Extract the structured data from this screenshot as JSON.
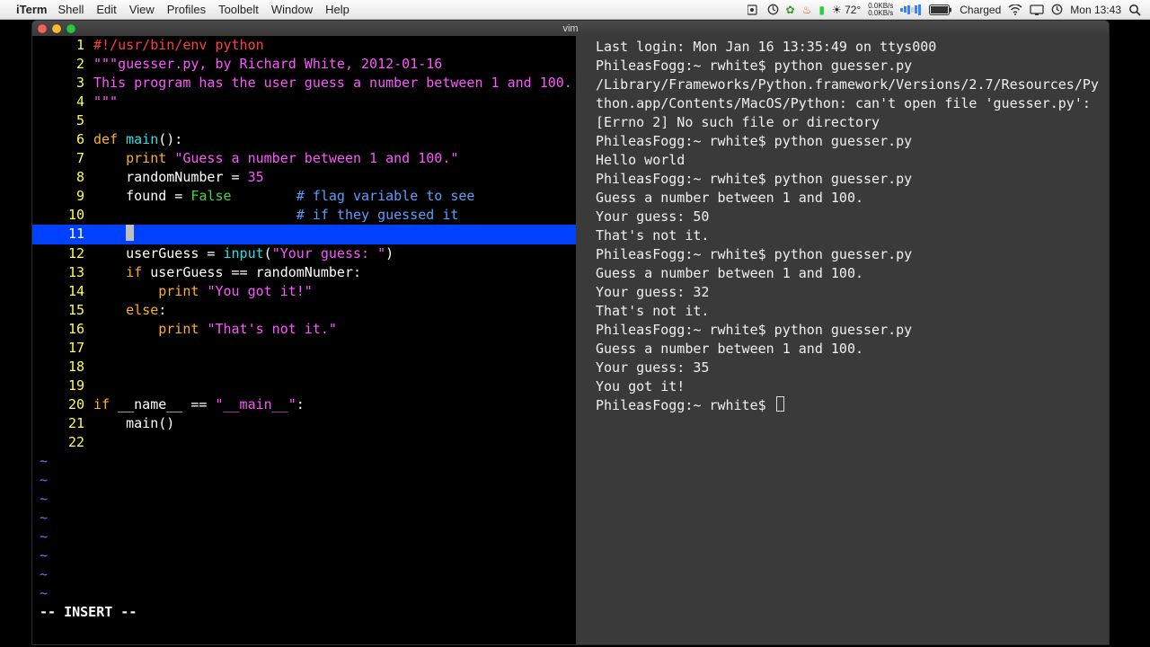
{
  "menubar": {
    "app": "iTerm",
    "menus": [
      "Shell",
      "Edit",
      "View",
      "Profiles",
      "Toolbelt",
      "Window",
      "Help"
    ],
    "weather": "☀ 72°",
    "net": "0.0KB/s\n0.0KB/s",
    "battery": "Charged",
    "clock": "Mon 13:43"
  },
  "window": {
    "title": "vim"
  },
  "vim": {
    "status": "-- INSERT --",
    "cursor_line": 11,
    "lines": [
      {
        "n": 1,
        "seg": [
          [
            "c-red",
            "#!/usr/bin/env python"
          ]
        ]
      },
      {
        "n": 2,
        "seg": [
          [
            "c-mag",
            "\"\"\"guesser.py, by Richard White, 2012-01-16"
          ]
        ]
      },
      {
        "n": 3,
        "seg": [
          [
            "c-mag",
            "This program has the user guess a number between 1 and 100."
          ]
        ]
      },
      {
        "n": 4,
        "seg": [
          [
            "c-mag",
            "\"\"\""
          ]
        ]
      },
      {
        "n": 5,
        "seg": [
          [
            "",
            ""
          ]
        ]
      },
      {
        "n": 6,
        "seg": [
          [
            "c-ora",
            "def "
          ],
          [
            "c-cyan",
            "main"
          ],
          [
            "",
            "():"
          ]
        ]
      },
      {
        "n": 7,
        "seg": [
          [
            "",
            "    "
          ],
          [
            "c-ora",
            "print "
          ],
          [
            "c-mag",
            "\"Guess a number between 1 and 100.\""
          ]
        ]
      },
      {
        "n": 8,
        "seg": [
          [
            "",
            "    randomNumber = "
          ],
          [
            "c-mag",
            "35"
          ]
        ]
      },
      {
        "n": 9,
        "seg": [
          [
            "",
            "    found = "
          ],
          [
            "c-grn",
            "False"
          ],
          [
            "",
            "        "
          ],
          [
            "c-blu",
            "# flag variable to see"
          ]
        ]
      },
      {
        "n": 10,
        "seg": [
          [
            "",
            "                         "
          ],
          [
            "c-blu",
            "# if they guessed it"
          ]
        ]
      },
      {
        "n": 11,
        "seg": [
          [
            "",
            "    "
          ]
        ]
      },
      {
        "n": 12,
        "seg": [
          [
            "",
            "    userGuess = "
          ],
          [
            "c-cyan",
            "input"
          ],
          [
            "",
            "("
          ],
          [
            "c-mag",
            "\"Your guess: \""
          ],
          [
            "",
            ")"
          ]
        ]
      },
      {
        "n": 13,
        "seg": [
          [
            "",
            "    "
          ],
          [
            "c-ora",
            "if"
          ],
          [
            "",
            " userGuess == randomNumber:"
          ]
        ]
      },
      {
        "n": 14,
        "seg": [
          [
            "",
            "        "
          ],
          [
            "c-ora",
            "print "
          ],
          [
            "c-mag",
            "\"You got it!\""
          ]
        ]
      },
      {
        "n": 15,
        "seg": [
          [
            "",
            "    "
          ],
          [
            "c-ora",
            "else"
          ],
          [
            "",
            ":"
          ]
        ]
      },
      {
        "n": 16,
        "seg": [
          [
            "",
            "        "
          ],
          [
            "c-ora",
            "print "
          ],
          [
            "c-mag",
            "\"That's not it.\""
          ]
        ]
      },
      {
        "n": 17,
        "seg": [
          [
            "",
            ""
          ]
        ]
      },
      {
        "n": 18,
        "seg": [
          [
            "",
            ""
          ]
        ]
      },
      {
        "n": 19,
        "seg": [
          [
            "",
            ""
          ]
        ]
      },
      {
        "n": 20,
        "seg": [
          [
            "c-ora",
            "if"
          ],
          [
            "",
            " __name__ == "
          ],
          [
            "c-mag",
            "\"__main__\""
          ],
          [
            "",
            ":"
          ]
        ]
      },
      {
        "n": 21,
        "seg": [
          [
            "",
            "    main()"
          ]
        ]
      },
      {
        "n": 22,
        "seg": [
          [
            "",
            ""
          ]
        ]
      }
    ],
    "tilde_rows": 8
  },
  "shell": {
    "lines": [
      "Last login: Mon Jan 16 13:35:49 on ttys000",
      "PhileasFogg:~ rwhite$ python guesser.py",
      "/Library/Frameworks/Python.framework/Versions/2.7/Resources/Python.app/Contents/MacOS/Python: can't open file 'guesser.py': [Errno 2] No such file or directory",
      "PhileasFogg:~ rwhite$ python guesser.py",
      "Hello world",
      "PhileasFogg:~ rwhite$ python guesser.py",
      "Guess a number between 1 and 100.",
      "Your guess: 50",
      "That's not it.",
      "PhileasFogg:~ rwhite$ python guesser.py",
      "Guess a number between 1 and 100.",
      "Your guess: 32",
      "That's not it.",
      "PhileasFogg:~ rwhite$ python guesser.py",
      "Guess a number between 1 and 100.",
      "Your guess: 35",
      "You got it!",
      "PhileasFogg:~ rwhite$ "
    ]
  }
}
